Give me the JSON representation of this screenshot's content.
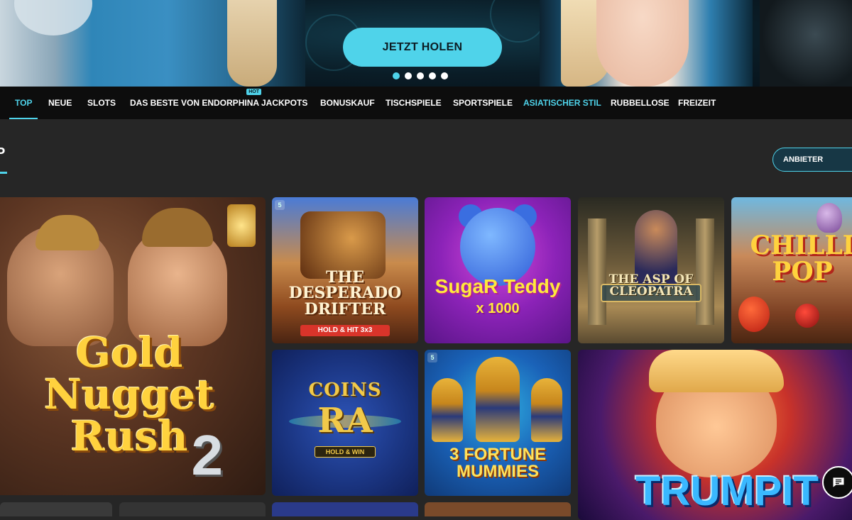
{
  "hero": {
    "cta_label": "JETZT HOLEN",
    "slides_total": 5,
    "active_slide": 1
  },
  "nav": {
    "items": [
      {
        "label": "TOP",
        "active": true
      },
      {
        "label": "NEUE"
      },
      {
        "label": "SLOTS"
      },
      {
        "label": "DAS BESTE VON ENDORPHINA",
        "badge": "HOT"
      },
      {
        "label": "JACKPOTS"
      },
      {
        "label": "BONUSKAUF"
      },
      {
        "label": "TISCHSPIELE"
      },
      {
        "label": "SPORTSPIELE"
      },
      {
        "label": "ASIATISCHER STIL"
      },
      {
        "label": "RUBBELLOSE"
      },
      {
        "label": "FREIZEIT"
      }
    ]
  },
  "section": {
    "title": "P",
    "provider_button": "ANBIETER"
  },
  "games": {
    "gold_nugget": {
      "line1": "Gold",
      "line2": "Nugget",
      "line3": "Rush",
      "number": "2"
    },
    "desperado": {
      "line1": "THE",
      "line2": "DESPERADO",
      "line3": "DRIFTER",
      "sub": "HOLD & HIT 3x3"
    },
    "sugar_teddy": {
      "title": "SugaR Teddy",
      "sub": "x 1000"
    },
    "asp_cleopatra": {
      "line1": "THE ASP OF",
      "line2": "CLEOPATRA"
    },
    "chilli_pop": {
      "line1": "CHILLI",
      "line2": "POP"
    },
    "coins_ra": {
      "line1": "COINS",
      "line2": "RA",
      "sub": "HOLD & WIN"
    },
    "fortune_mummies": {
      "line1": "3 FORTUNE",
      "line2": "MUMMIES"
    },
    "trump": {
      "title": "TRUMPIT"
    }
  },
  "icons": {
    "chat": "chat-icon"
  },
  "colors": {
    "accent": "#4fd3ea",
    "background": "#262626",
    "nav_background": "#0d0d0d"
  }
}
